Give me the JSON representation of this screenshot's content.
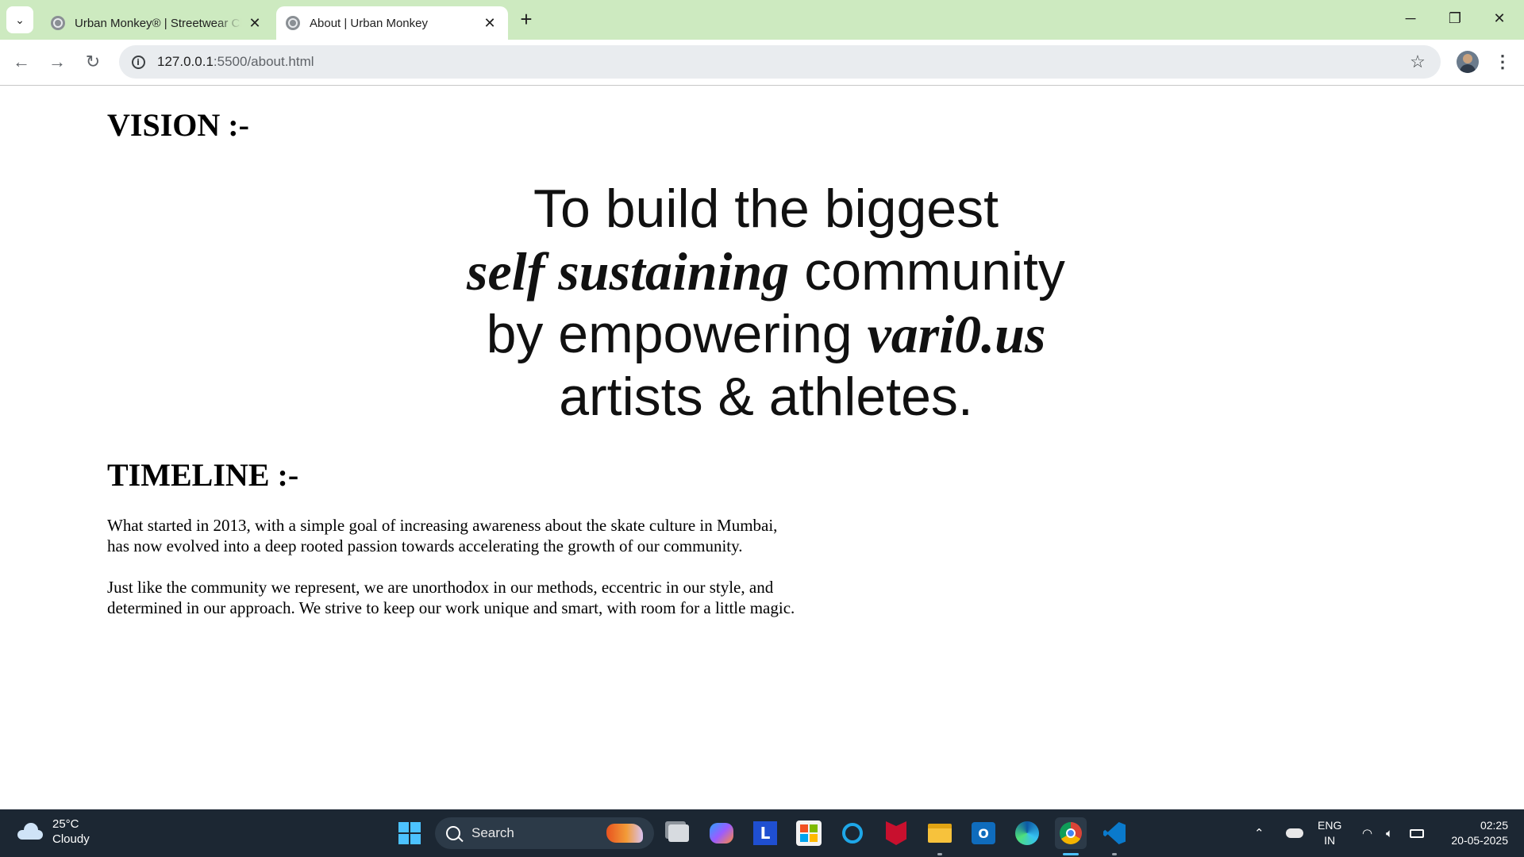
{
  "browser": {
    "tabs": [
      {
        "title": "Urban Monkey® | Streetwear Clothing",
        "active": false
      },
      {
        "title": "About | Urban Monkey",
        "active": true
      }
    ],
    "new_tab": "+",
    "window_controls": {
      "minimize": "─",
      "restore": "❐",
      "close": "✕"
    },
    "url": {
      "host": "127.0.0.1",
      "rest": ":5500/about.html"
    }
  },
  "page": {
    "vision_heading": "VISION :-",
    "vision_image_text": {
      "line1": "To build the biggest",
      "line2_bold": "self sustaining",
      "line2_rest": " community",
      "line3_start": "by empowering ",
      "line3_bold": "vari0.us",
      "line4": "artists & athletes."
    },
    "timeline_heading": "TIMELINE :-",
    "paragraph1_line1": "What started in 2013, with a simple goal of increasing awareness about the skate culture in Mumbai,",
    "paragraph1_line2": "has now evolved into a deep rooted passion towards accelerating the growth of our community.",
    "paragraph2_line1": "Just like the community we represent, we are unorthodox in our methods, eccentric in our style, and",
    "paragraph2_line2": "determined in our approach. We strive to keep our work unique and smart, with room for a little magic."
  },
  "taskbar": {
    "weather": {
      "temp": "25°C",
      "condition": "Cloudy"
    },
    "search_label": "Search",
    "apps": [
      "task-view",
      "copilot",
      "l-app",
      "microsoft-store",
      "cortana",
      "mcafee",
      "file-explorer",
      "outlook",
      "edge",
      "chrome",
      "vscode"
    ],
    "language": {
      "line1": "ENG",
      "line2": "IN"
    },
    "time": "02:25",
    "date": "20-05-2025"
  },
  "colors": {
    "tabstrip": "#cdeac0",
    "omnibox": "#e9ecef",
    "taskbar": "#1c2733",
    "accent": "#4cc2ff"
  }
}
